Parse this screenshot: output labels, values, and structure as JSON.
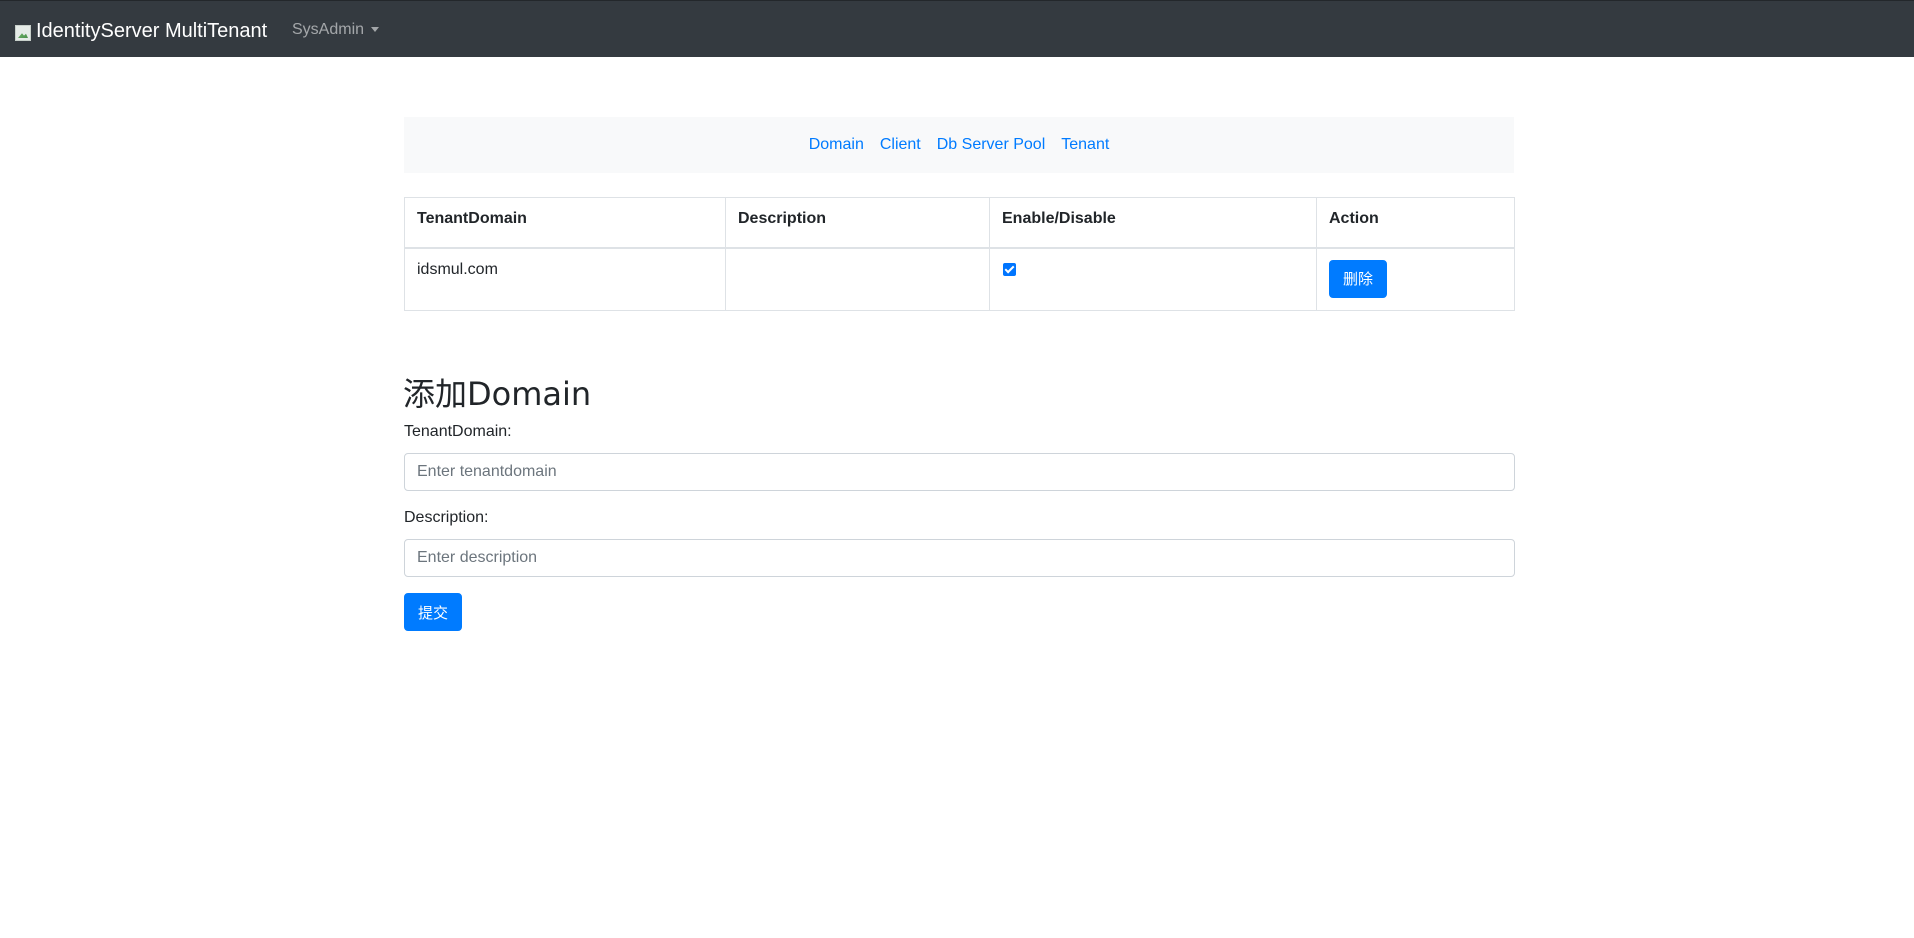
{
  "navbar": {
    "brand": "IdentityServer MultiTenant",
    "menu": "SysAdmin"
  },
  "subnav": {
    "links": [
      "Domain",
      "Client",
      "Db Server Pool",
      "Tenant"
    ]
  },
  "table": {
    "headers": [
      "TenantDomain",
      "Description",
      "Enable/Disable",
      "Action"
    ],
    "rows": [
      {
        "tenant_domain": "idsmul.com",
        "description": "",
        "enabled": true,
        "action_label": "删除"
      }
    ]
  },
  "form": {
    "title": "添加Domain",
    "tenant_domain_label": "TenantDomain:",
    "tenant_domain_placeholder": "Enter tenantdomain",
    "description_label": "Description:",
    "description_placeholder": "Enter description",
    "submit_label": "提交"
  },
  "colors": {
    "navbar_bg": "#343a40",
    "primary": "#007bff",
    "subnav_bg": "#f8f9fa"
  }
}
